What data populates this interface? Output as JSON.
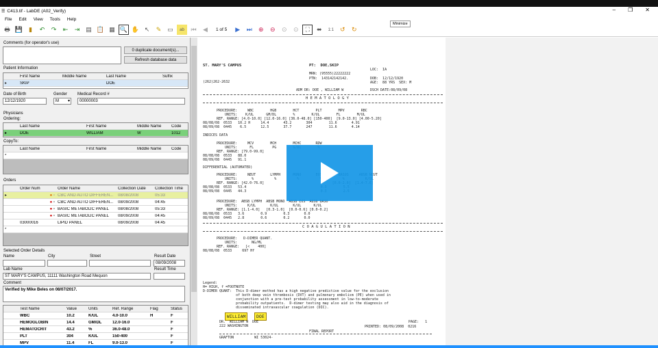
{
  "window": {
    "title": "C413.tif - LabDE (A02_Verify)",
    "minimize": "–",
    "restore": "❐",
    "close": "✕",
    "tooltip": "Minimize"
  },
  "menu": [
    "File",
    "Edit",
    "View",
    "Tools",
    "Help"
  ],
  "toolbar": {
    "page_count": "1 of 5"
  },
  "comments": {
    "label": "Comments (for operator's use)",
    "dup_button": "0 duplicate document(s)...",
    "refresh_button": "Refresh database data"
  },
  "patient": {
    "label": "Patient Information",
    "cols": [
      "First Name",
      "Middle Name",
      "Last Name",
      "Suffix"
    ],
    "row": [
      "SKIP",
      "",
      "DOE",
      ""
    ],
    "dob_label": "Date of Birth",
    "dob": "12/12/1920",
    "gender_label": "Gender",
    "gender": "M",
    "mrn_label": "Medical Record #",
    "mrn": "00000003"
  },
  "physicians": {
    "label": "Physicians",
    "ordering_label": "Ordering:",
    "cols": [
      "Last Name",
      "First Name",
      "Middle Name",
      "Code"
    ],
    "row": [
      "DOE",
      "WILLIAM",
      "W",
      "1012"
    ],
    "copyto_label": "CopyTo:"
  },
  "orders": {
    "label": "Orders",
    "cols": [
      "Order Num",
      "Order Name",
      "Collection Date",
      "Collection Time"
    ],
    "rows": [
      {
        "num": "",
        "name": "CBC AND AUTO DIFFEREN...",
        "date": "08/08/2008",
        "time": "05:33"
      },
      {
        "num": "",
        "name": "CBC AND AUTO DIFFEREN...",
        "date": "08/09/2008",
        "time": "04:45"
      },
      {
        "num": "",
        "name": "BASIC METABOLIC PANEL",
        "date": "08/08/2008",
        "time": "05:33"
      },
      {
        "num": "",
        "name": "BASIC METABOLIC PANEL",
        "date": "08/09/2008",
        "time": "04:45"
      },
      {
        "num": "03000016",
        "name": "LIPID PANEL",
        "date": "08/09/2008",
        "time": "04:45"
      }
    ]
  },
  "selected": {
    "label": "Selected Order Details",
    "name_label": "Name",
    "city_label": "City",
    "street_label": "Street",
    "result_date_label": "Result Date",
    "result_date": "08/09/2008",
    "labname_label": "Lab Name",
    "labname": "ST MARY'S CAMPUS, 11111 Washington Road Mequon",
    "result_time_label": "Result Time",
    "comment_label": "Comment",
    "comment": "Verified by Mike Beles on 08/07/2017."
  },
  "tests": {
    "cols": [
      "Test Name",
      "Value",
      "Units",
      "Ref. Range",
      "Flag",
      "Status"
    ],
    "rows": [
      [
        "WBC",
        "10.2",
        "K/UL",
        "4.0-10.0",
        "H",
        "F"
      ],
      [
        "HEMOGLOBIN",
        "14.4",
        "GM/DL",
        "12.0-16.0",
        "",
        "F"
      ],
      [
        "HEMATOCRIT",
        "43.2",
        "%",
        "36.0-48.0",
        "",
        "F"
      ],
      [
        "PLT",
        "304",
        "K/UL",
        "150-400",
        "",
        "F"
      ],
      [
        "MPV",
        "11.4",
        "FL",
        "9.0-13.0",
        "",
        "F"
      ]
    ]
  },
  "doc": {
    "campus": "ST. MARY'S CAMPUS",
    "phone": "(262)262-2632",
    "pt": "PT:  DOE,SKIP",
    "mrn": "MRN: (95555)22222222",
    "ptn": "PTN:  143142142142.",
    "loc": "LOC:  IA",
    "dob": "DOB:  12/12/1920",
    "age": "AGE:  88 YRS  SEX: M",
    "adm": "ADM DR: DOE , WILLIAM W",
    "dsch": "DSCH DATE:08/09/08",
    "hem_title": "H E M A T O L O G Y",
    "hem_head": "PROCEDURE:     WBC        HGB        HCT        PLT        MPV        RBC",
    "hem_units": "    UNITS:    K/UL      GM/DL        %        K/UL        FL        M/UL",
    "hem_ref": "REF. RANGE: [4.0-10.0] [12.0-16.0] [36.0-48.0] [150-400]  [9.0-13.0] [4.00-5.20]",
    "hem_r1": "08/08/08  0533   10.2 H     14.4       43.2       304        11.6       4.91",
    "hem_r2": "08/09/08  0445    6.5       12.5       37.7       247        11.6       4.14",
    "indices": "INDICES DATA",
    "ind_head": "PROCEDURE:     MCV        MCH        MCHC       RDW",
    "ind_units": "    UNITS:      FL         PG        G/DL        %",
    "ind_ref": "REF. RANGE: [79.0-99.0]",
    "ind_r1": "08/08/08  0533   88.0",
    "ind_r2": "08/09/08  0445   91.1",
    "diff": "DIFFERENTIAL (AUTOMATED)",
    "diff_head": "PROCEDURE:     NEUT       LYMPH      MONO       EOS        BASOS     ABSB NEUT",
    "diff_units": "    UNITS:       %          %          %          %          %          K/UL",
    "diff_ref": "REF. RANGE: [42.0-76.0]                                 [0.0-2.0]  [1.4-7.6]",
    "diff_r1": "08/08/08  0533   53.4                                    0.3        5.5",
    "diff_r2": "08/09/08  0445   44.3                                    0.3        2.5",
    "abs_head": "PROCEDURE:  ABSB LYMPH  ABSB MONO  ABSB EOS  ABSB BASO",
    "abs_units": "    UNITS:     K/UL       K/UL       K/UL      K/UL",
    "abs_ref": "REF. RANGE: [1.1-4.0]   [0.3-1.0]  [0.0-0.6] [0.0-0.2]",
    "abs_r1": "08/08/08  0533   3.6        0.9        0.3       0.0",
    "abs_r2": "08/09/08  0445   2.8        0.6        0.2       0.0",
    "coag_title": "C O A G U L A T I O N",
    "coag_head": "PROCEDURE:   D-DIMER QUANT.",
    "coag_units": "    UNITS:       NG/ML",
    "coag_ref": "REF. RANGE:   [<    400]",
    "coag_r1": "08/08/08  0533     697 Hf",
    "legend1": "Legend:",
    "legend2": "H= HIGH, f =FOOTNOTE",
    "legend3": "D-DIMER QUANT:  This D-dimer method has a high negative predictive value for the exclusion",
    "legend4": "                of both deep vein thrombosis (DVT) and pulmonary embolism (PE) when used in",
    "legend5": "                conjunction with a pre-test probability assessment in low-to-moderate",
    "legend6": "                probability outpatients.  D-dimer testing may also aid in the diagnosis of",
    "legend7": "                disseminated intravascular coagulation (DIC).",
    "sig_first": "WILLIAM",
    "sig_last": "DOE",
    "dr_line": "DR.  WILLIAM W  DOE",
    "page": "PAGE:   1",
    "addr1": "222 WASHINGTON",
    "printed": "PRINTED: 08/09/2008  0216",
    "final": "FINAL REPORT",
    "addr2": "GRAFTON          WI 53024-"
  },
  "colors": {
    "accent": "#1496e6",
    "ordering_selected": "#7ad07a",
    "order_selected": "#e8f0a0",
    "highlight": "#ffef33"
  }
}
